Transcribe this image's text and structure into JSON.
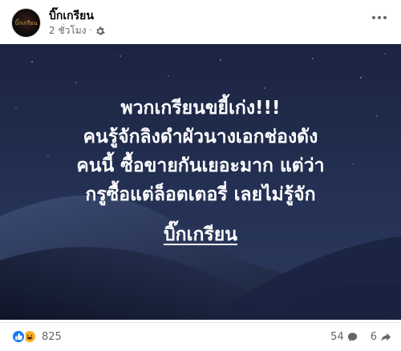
{
  "header": {
    "avatar_text": "บิ๊กเกรียน",
    "page_name": "บิ๊กเกรียน",
    "timestamp": "2 ชั่วโมง",
    "separator": "·"
  },
  "caption": {
    "lines": [
      "พวกเกรียนขยี้เก่ง!!!",
      "คนรู้จักลิงดำผัวนางเอกช่องดัง",
      "คนนี้ ซื้อขายกันเยอะมาก แต่ว่า",
      "กรูซื้อแต่ล็อตเตอรี่ เลยไม่รู้จัก"
    ],
    "signature": "บิ๊กเกรียน"
  },
  "footer": {
    "reaction_count": "825",
    "comment_count": "54",
    "share_count": "6"
  },
  "icons": {
    "like": "like-icon",
    "haha": "haha-icon",
    "comment": "comment-icon",
    "share": "share-icon",
    "globe": "gear-icon"
  },
  "colors": {
    "like_blue": "#1877f2",
    "haha_yellow": "#f7b125",
    "muted_text": "#65676b",
    "image_bg": "#16213a"
  }
}
